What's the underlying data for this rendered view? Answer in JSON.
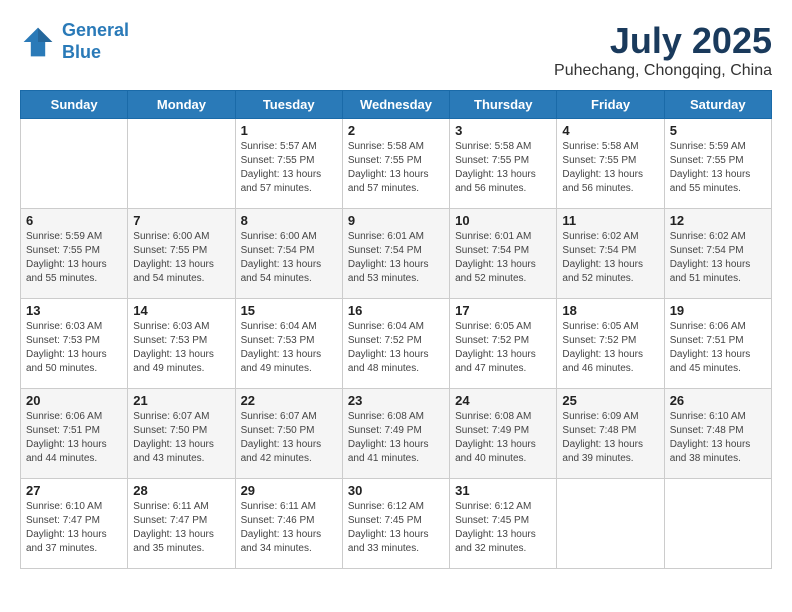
{
  "header": {
    "logo_line1": "General",
    "logo_line2": "Blue",
    "month": "July 2025",
    "location": "Puhechang, Chongqing, China"
  },
  "weekdays": [
    "Sunday",
    "Monday",
    "Tuesday",
    "Wednesday",
    "Thursday",
    "Friday",
    "Saturday"
  ],
  "weeks": [
    [
      {
        "day": "",
        "info": ""
      },
      {
        "day": "",
        "info": ""
      },
      {
        "day": "1",
        "info": "Sunrise: 5:57 AM\nSunset: 7:55 PM\nDaylight: 13 hours and 57 minutes."
      },
      {
        "day": "2",
        "info": "Sunrise: 5:58 AM\nSunset: 7:55 PM\nDaylight: 13 hours and 57 minutes."
      },
      {
        "day": "3",
        "info": "Sunrise: 5:58 AM\nSunset: 7:55 PM\nDaylight: 13 hours and 56 minutes."
      },
      {
        "day": "4",
        "info": "Sunrise: 5:58 AM\nSunset: 7:55 PM\nDaylight: 13 hours and 56 minutes."
      },
      {
        "day": "5",
        "info": "Sunrise: 5:59 AM\nSunset: 7:55 PM\nDaylight: 13 hours and 55 minutes."
      }
    ],
    [
      {
        "day": "6",
        "info": "Sunrise: 5:59 AM\nSunset: 7:55 PM\nDaylight: 13 hours and 55 minutes."
      },
      {
        "day": "7",
        "info": "Sunrise: 6:00 AM\nSunset: 7:55 PM\nDaylight: 13 hours and 54 minutes."
      },
      {
        "day": "8",
        "info": "Sunrise: 6:00 AM\nSunset: 7:54 PM\nDaylight: 13 hours and 54 minutes."
      },
      {
        "day": "9",
        "info": "Sunrise: 6:01 AM\nSunset: 7:54 PM\nDaylight: 13 hours and 53 minutes."
      },
      {
        "day": "10",
        "info": "Sunrise: 6:01 AM\nSunset: 7:54 PM\nDaylight: 13 hours and 52 minutes."
      },
      {
        "day": "11",
        "info": "Sunrise: 6:02 AM\nSunset: 7:54 PM\nDaylight: 13 hours and 52 minutes."
      },
      {
        "day": "12",
        "info": "Sunrise: 6:02 AM\nSunset: 7:54 PM\nDaylight: 13 hours and 51 minutes."
      }
    ],
    [
      {
        "day": "13",
        "info": "Sunrise: 6:03 AM\nSunset: 7:53 PM\nDaylight: 13 hours and 50 minutes."
      },
      {
        "day": "14",
        "info": "Sunrise: 6:03 AM\nSunset: 7:53 PM\nDaylight: 13 hours and 49 minutes."
      },
      {
        "day": "15",
        "info": "Sunrise: 6:04 AM\nSunset: 7:53 PM\nDaylight: 13 hours and 49 minutes."
      },
      {
        "day": "16",
        "info": "Sunrise: 6:04 AM\nSunset: 7:52 PM\nDaylight: 13 hours and 48 minutes."
      },
      {
        "day": "17",
        "info": "Sunrise: 6:05 AM\nSunset: 7:52 PM\nDaylight: 13 hours and 47 minutes."
      },
      {
        "day": "18",
        "info": "Sunrise: 6:05 AM\nSunset: 7:52 PM\nDaylight: 13 hours and 46 minutes."
      },
      {
        "day": "19",
        "info": "Sunrise: 6:06 AM\nSunset: 7:51 PM\nDaylight: 13 hours and 45 minutes."
      }
    ],
    [
      {
        "day": "20",
        "info": "Sunrise: 6:06 AM\nSunset: 7:51 PM\nDaylight: 13 hours and 44 minutes."
      },
      {
        "day": "21",
        "info": "Sunrise: 6:07 AM\nSunset: 7:50 PM\nDaylight: 13 hours and 43 minutes."
      },
      {
        "day": "22",
        "info": "Sunrise: 6:07 AM\nSunset: 7:50 PM\nDaylight: 13 hours and 42 minutes."
      },
      {
        "day": "23",
        "info": "Sunrise: 6:08 AM\nSunset: 7:49 PM\nDaylight: 13 hours and 41 minutes."
      },
      {
        "day": "24",
        "info": "Sunrise: 6:08 AM\nSunset: 7:49 PM\nDaylight: 13 hours and 40 minutes."
      },
      {
        "day": "25",
        "info": "Sunrise: 6:09 AM\nSunset: 7:48 PM\nDaylight: 13 hours and 39 minutes."
      },
      {
        "day": "26",
        "info": "Sunrise: 6:10 AM\nSunset: 7:48 PM\nDaylight: 13 hours and 38 minutes."
      }
    ],
    [
      {
        "day": "27",
        "info": "Sunrise: 6:10 AM\nSunset: 7:47 PM\nDaylight: 13 hours and 37 minutes."
      },
      {
        "day": "28",
        "info": "Sunrise: 6:11 AM\nSunset: 7:47 PM\nDaylight: 13 hours and 35 minutes."
      },
      {
        "day": "29",
        "info": "Sunrise: 6:11 AM\nSunset: 7:46 PM\nDaylight: 13 hours and 34 minutes."
      },
      {
        "day": "30",
        "info": "Sunrise: 6:12 AM\nSunset: 7:45 PM\nDaylight: 13 hours and 33 minutes."
      },
      {
        "day": "31",
        "info": "Sunrise: 6:12 AM\nSunset: 7:45 PM\nDaylight: 13 hours and 32 minutes."
      },
      {
        "day": "",
        "info": ""
      },
      {
        "day": "",
        "info": ""
      }
    ]
  ]
}
